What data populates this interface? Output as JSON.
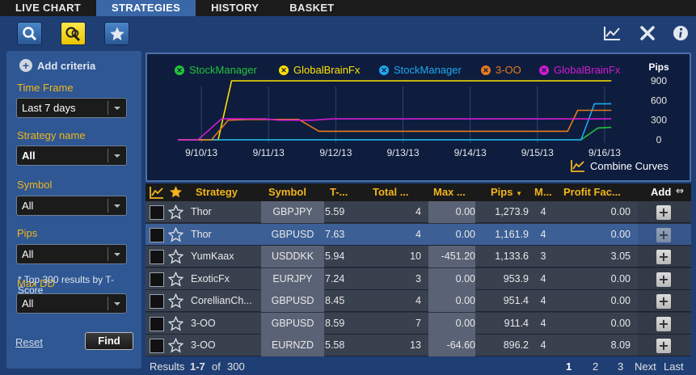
{
  "tabs": [
    "LIVE CHART",
    "STRATEGIES",
    "HISTORY",
    "BASKET"
  ],
  "toolbar": {
    "left_icons": [
      "search-icon",
      "compare-search-icon",
      "favorites-star-icon"
    ],
    "right_icons": [
      "chart-icon",
      "excel-export-icon",
      "info-icon"
    ]
  },
  "sidebar": {
    "add_criteria": "Add criteria",
    "filters": [
      {
        "label": "Time Frame",
        "value": "Last 7 days"
      },
      {
        "label": "Strategy name",
        "value": "All"
      },
      {
        "label": "Symbol",
        "value": "All"
      },
      {
        "label": "Pips",
        "value": "All"
      },
      {
        "label": "Max DD",
        "value": "All"
      }
    ],
    "note": "* Top 300 results by T-Score",
    "reset": "Reset",
    "find": "Find"
  },
  "chart": {
    "legend": [
      {
        "name": "StockManager",
        "color": "#23c43a"
      },
      {
        "name": "GlobalBrainFx",
        "color": "#ffe100"
      },
      {
        "name": "StockManager",
        "color": "#1ea9f0"
      },
      {
        "name": "3-OO",
        "color": "#e87a1c"
      },
      {
        "name": "GlobalBrainFx",
        "color": "#d21ad2"
      }
    ],
    "pips_label": "Pips",
    "combine": "Combine Curves"
  },
  "chart_data": {
    "type": "line",
    "x": [
      "9/10/13",
      "9/11/13",
      "9/12/13",
      "9/13/13",
      "9/14/13",
      "9/15/13",
      "9/16/13"
    ],
    "ylabel": "Pips",
    "yticks": [
      0,
      300,
      600,
      900
    ],
    "ylim": [
      -60,
      1000
    ],
    "series": [
      {
        "name": "StockManager",
        "color": "#23c43a",
        "points": [
          [
            0,
            0
          ],
          [
            6.0,
            0
          ],
          [
            6.25,
            180
          ],
          [
            6.45,
            190
          ]
        ]
      },
      {
        "name": "GlobalBrainFx",
        "color": "#ffe100",
        "points": [
          [
            0,
            0
          ],
          [
            0.6,
            0
          ],
          [
            0.8,
            900
          ],
          [
            6.45,
            900
          ]
        ]
      },
      {
        "name": "StockManager",
        "color": "#1ea9f0",
        "points": [
          [
            0,
            0
          ],
          [
            6.0,
            0
          ],
          [
            6.2,
            550
          ],
          [
            6.45,
            550
          ]
        ]
      },
      {
        "name": "3-OO",
        "color": "#e87a1c",
        "points": [
          [
            0,
            0
          ],
          [
            0.5,
            0
          ],
          [
            0.75,
            300
          ],
          [
            1.05,
            310
          ],
          [
            1.8,
            310
          ],
          [
            2.1,
            130
          ],
          [
            5.8,
            130
          ],
          [
            5.95,
            450
          ],
          [
            6.45,
            450
          ]
        ]
      },
      {
        "name": "GlobalBrainFx",
        "color": "#d21ad2",
        "points": [
          [
            0,
            0
          ],
          [
            0.3,
            0
          ],
          [
            0.65,
            320
          ],
          [
            1.3,
            320
          ],
          [
            1.5,
            300
          ],
          [
            2.0,
            300
          ],
          [
            2.3,
            320
          ],
          [
            6.45,
            320
          ]
        ]
      }
    ]
  },
  "table": {
    "columns": [
      "Strategy",
      "Symbol",
      "T-...",
      "Total ...",
      "Max ...",
      "Pips",
      "M...",
      "Profit Fac...",
      "Add"
    ],
    "rows": [
      [
        "Thor",
        "GBPJPY",
        "5.59",
        "4",
        "0.00",
        "1,273.9",
        "4",
        "0.00"
      ],
      [
        "Thor",
        "GBPUSD",
        "7.63",
        "4",
        "0.00",
        "1,161.9",
        "4",
        "0.00"
      ],
      [
        "YumKaax",
        "USDDKK",
        "5.94",
        "10",
        "-451.20",
        "1,133.6",
        "3",
        "3.05"
      ],
      [
        "ExoticFx",
        "EURJPY",
        "7.24",
        "3",
        "0.00",
        "953.9",
        "4",
        "0.00"
      ],
      [
        "CorellianCh...",
        "GBPUSD",
        "8.45",
        "4",
        "0.00",
        "951.4",
        "4",
        "0.00"
      ],
      [
        "3-OO",
        "GBPUSD",
        "8.59",
        "7",
        "0.00",
        "911.4",
        "4",
        "0.00"
      ],
      [
        "3-OO",
        "EURNZD",
        "5.58",
        "13",
        "-64.60",
        "896.2",
        "4",
        "8.09"
      ]
    ],
    "footer": {
      "results": "Results",
      "range": "1-7",
      "of": "of",
      "total": "300",
      "pages": [
        "1",
        "2",
        "3"
      ],
      "next": "Next",
      "last": "Last"
    }
  },
  "colors": {
    "accent": "#f2b51a",
    "panel": "#2e5793",
    "selected_row": "#3c5f96"
  }
}
